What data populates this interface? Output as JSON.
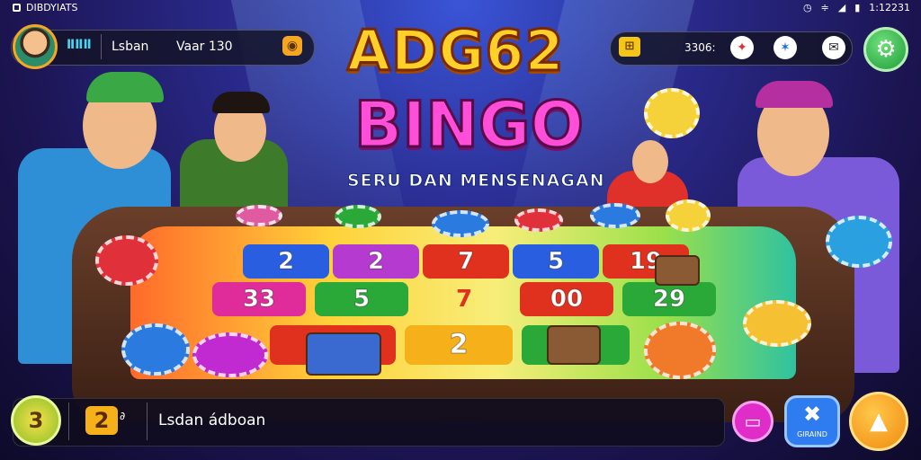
{
  "status_bar": {
    "left_text": "DIBDYIATS",
    "time": "1:12231"
  },
  "profile": {
    "stat_icon": "ⅡⅡⅡ",
    "name": "Lsban",
    "value": "Vaar 130"
  },
  "top_right": {
    "value": "3306:"
  },
  "title": {
    "line1": "ADG62",
    "line2": "BINGO",
    "subtitle": "SERU DAN MENSENAGAN"
  },
  "board": {
    "row1": [
      "2",
      "2",
      "7",
      "5",
      "19"
    ],
    "row2": [
      "33",
      "5",
      "7",
      "00",
      "29"
    ],
    "row3": [
      "",
      "",
      "2",
      "",
      ""
    ]
  },
  "bottom_bar": {
    "icon1_label": "3",
    "icon2_label": "2",
    "text": "Lsdan ádboan",
    "tool_label": "GIRAIND"
  },
  "colors": {
    "accent_yellow": "#ffcf2a",
    "accent_pink": "#ff4fd8",
    "settings_green": "#1e9c3a",
    "bottom_orange": "#f5a21a",
    "bottom_blue": "#2f7bf0",
    "bottom_magenta": "#e02cc8"
  }
}
